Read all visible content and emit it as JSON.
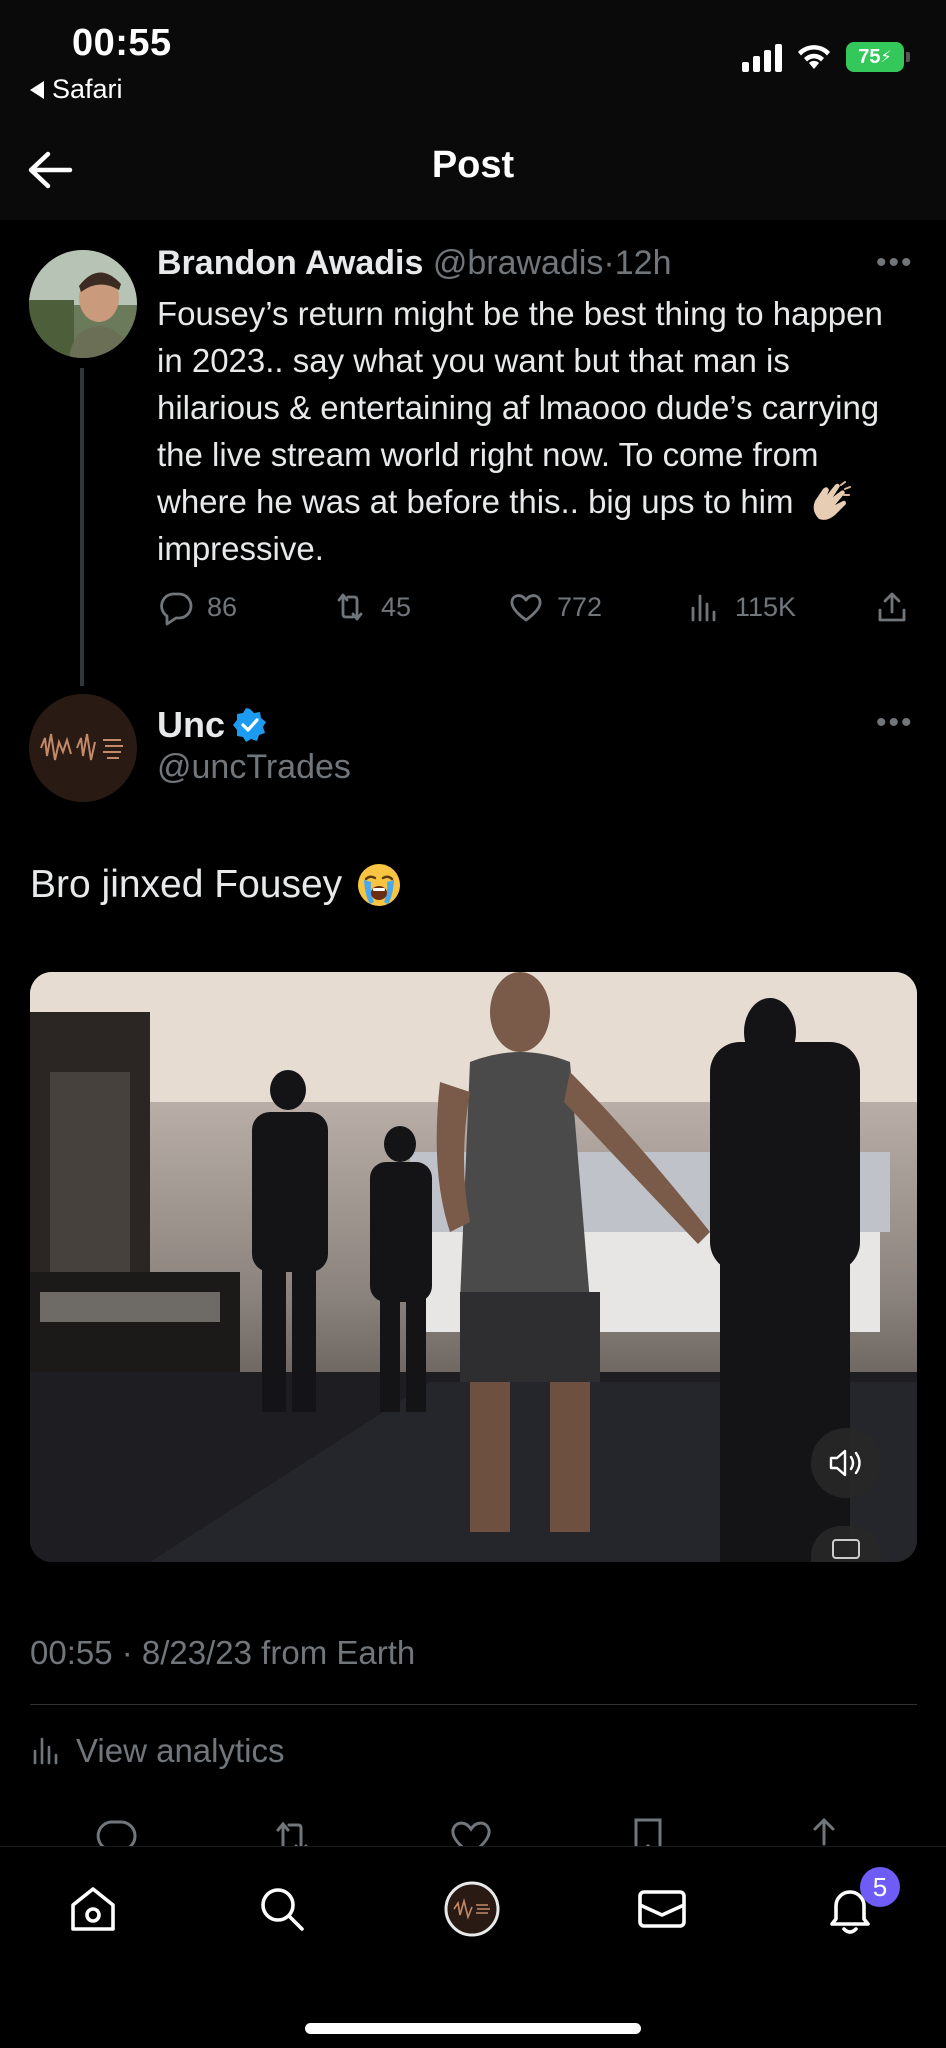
{
  "status_bar": {
    "time": "00:55",
    "back_app": "Safari",
    "battery": "75"
  },
  "header": {
    "title": "Post",
    "back_icon": "arrow-left-icon"
  },
  "parent_tweet": {
    "author_name": "Brandon Awadis",
    "author_handle": "@brawadis",
    "separator": "·",
    "time_ago": "12h",
    "text_before_emoji": "Fousey’s return might be the best thing to happen in 2023.. say what you want but that man is hilarious & entertaining af lmaooo dude’s carrying the live stream world right now. To come from where he was at before this.. big ups to him",
    "text_after_emoji": "impressive.",
    "emoji": "clapping-hands",
    "replies": "86",
    "reposts": "45",
    "likes": "772",
    "views": "115K"
  },
  "main_tweet": {
    "author_name": "Unc",
    "author_handle": "@uncTrades",
    "verified": true,
    "text": "Bro jinxed Fousey",
    "emoji": "loudly-crying-face",
    "timestamp": "00:55 · 8/23/23 from Earth",
    "view_analytics": "View analytics"
  },
  "tab_bar": {
    "items": [
      "home",
      "search",
      "spaces",
      "messages",
      "notifications"
    ],
    "notification_count": "5"
  },
  "colors": {
    "background": "#000000",
    "text": "#e7e9ea",
    "muted": "#71767b",
    "verified": "#1d9bf0",
    "badge": "#6f5cf6",
    "battery": "#34c759"
  }
}
